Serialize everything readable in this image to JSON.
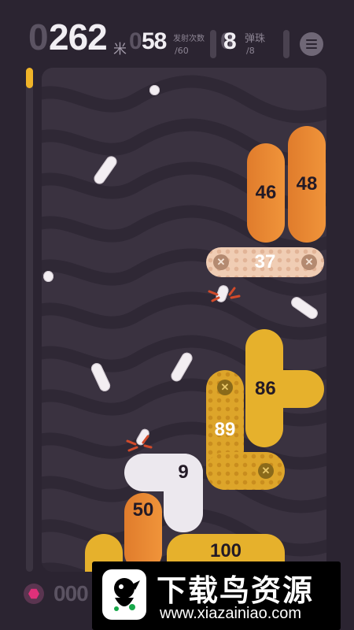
{
  "hud": {
    "distance_lead": "0",
    "distance": "262",
    "distance_unit": "米",
    "shots_lead": "0",
    "shots": "58",
    "shots_label": "发射次数",
    "shots_total": "/60",
    "balls_lead": "0",
    "balls": "8",
    "balls_label": "弹珠",
    "balls_total": "/8",
    "menu_icon": "hamburger-menu-icon"
  },
  "progress": {
    "fraction": 0.04,
    "color": "#f0b429"
  },
  "blocks": [
    {
      "id": "block-46",
      "label": "46",
      "style": "orange"
    },
    {
      "id": "block-48",
      "label": "48",
      "style": "orange"
    },
    {
      "id": "block-37",
      "label": "37",
      "style": "pink-dotted"
    },
    {
      "id": "block-86",
      "label": "86",
      "style": "yellow"
    },
    {
      "id": "block-89",
      "label": "89",
      "style": "yellow-dotted"
    },
    {
      "id": "block-9",
      "label": "9",
      "style": "white"
    },
    {
      "id": "block-50",
      "label": "50",
      "style": "orange"
    },
    {
      "id": "block-100",
      "label": "100",
      "style": "yellow"
    }
  ],
  "bottom": {
    "counter": "000",
    "button_icon": "hexagon-icon",
    "watermark_title": "下载鸟资源",
    "watermark_url": "www.xiazainiao.com"
  },
  "colors": {
    "background": "#2b2431",
    "field": "#3a3240",
    "orange": "#ea8833",
    "yellow": "#e6b12c",
    "pink": "#f0cdb4",
    "ball": "#f3eef2"
  }
}
